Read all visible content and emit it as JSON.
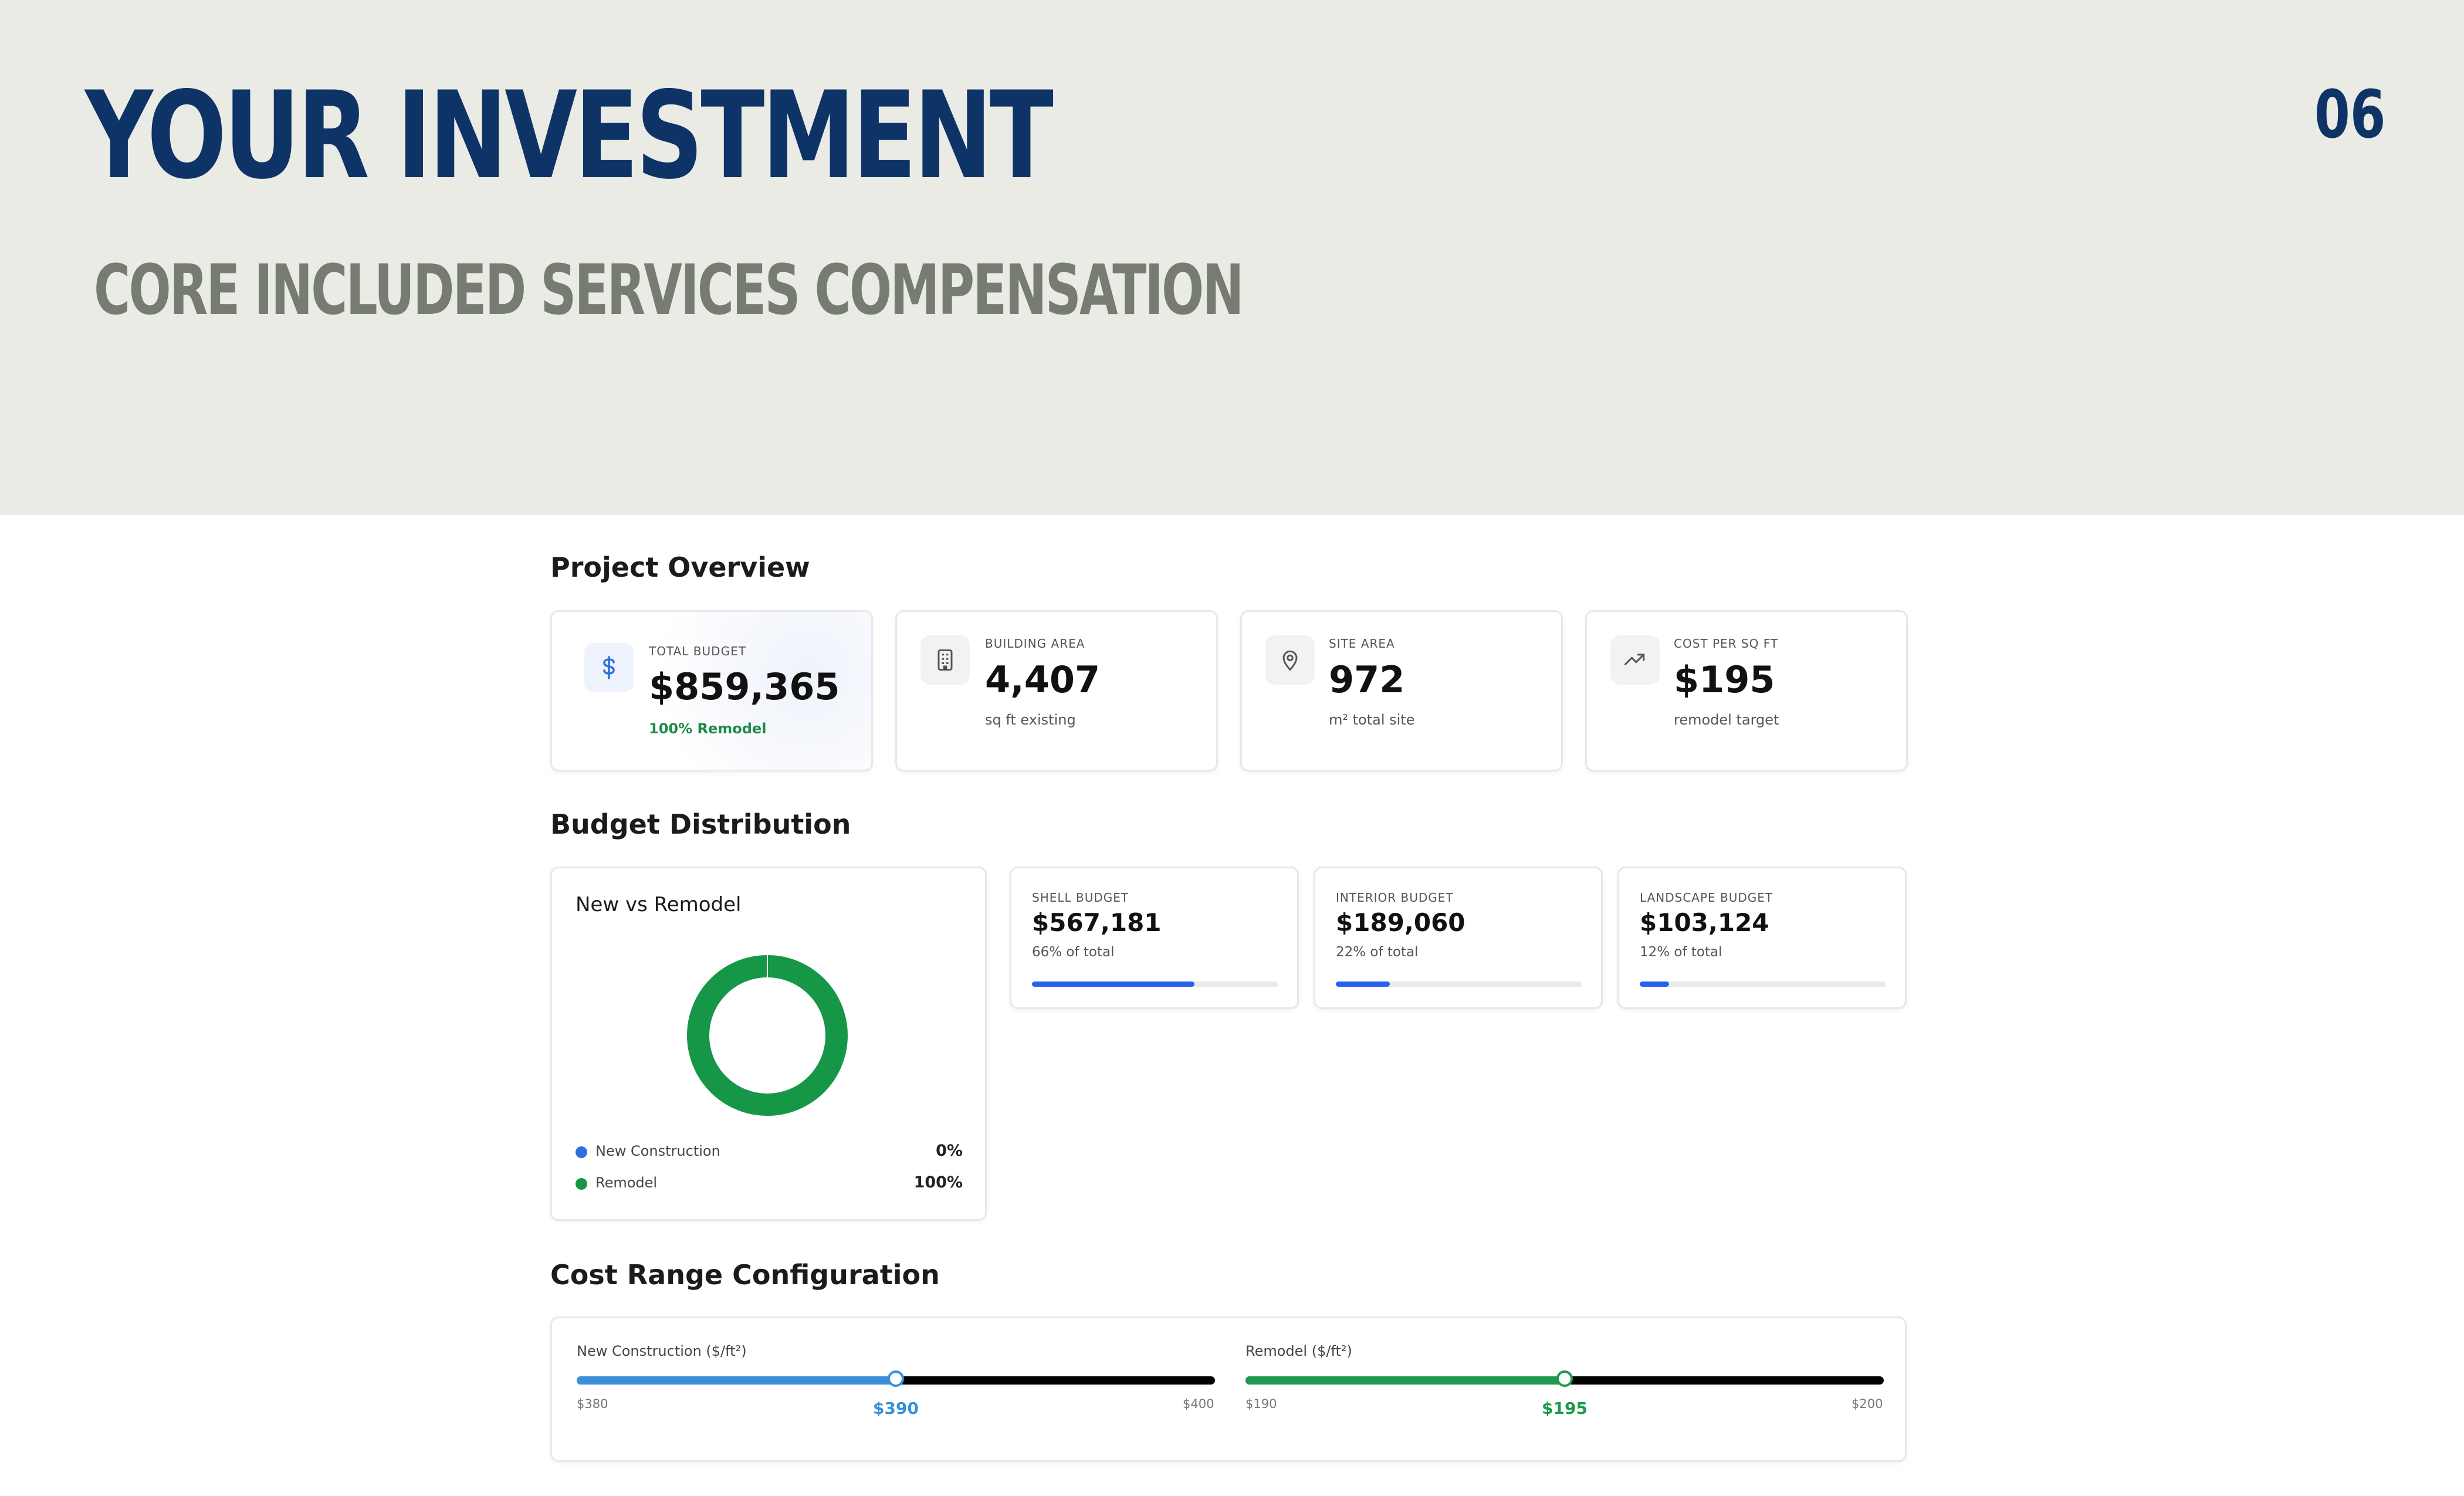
{
  "header": {
    "title": "YOUR INVESTMENT",
    "subtitle": "CORE INCLUDED SERVICES COMPENSATION",
    "page_number": "06"
  },
  "overview": {
    "heading": "Project Overview",
    "cards": [
      {
        "icon": "dollar-icon",
        "label": "TOTAL BUDGET",
        "value": "$859,365",
        "sub": "100% Remodel"
      },
      {
        "icon": "building-icon",
        "label": "BUILDING AREA",
        "value": "4,407",
        "sub": "sq ft existing"
      },
      {
        "icon": "map-pin-icon",
        "label": "SITE AREA",
        "value": "972",
        "sub": "m² total site"
      },
      {
        "icon": "trend-up-icon",
        "label": "COST PER SQ FT",
        "value": "$195",
        "sub": "remodel target"
      }
    ]
  },
  "budget": {
    "heading": "Budget Distribution",
    "chart": {
      "title": "New vs Remodel",
      "items": [
        {
          "name": "New Construction",
          "percent": 0,
          "display": "0%",
          "color": "#2f6fe0"
        },
        {
          "name": "Remodel",
          "percent": 100,
          "display": "100%",
          "color": "#169748"
        }
      ]
    },
    "breakdown": [
      {
        "label": "SHELL BUDGET",
        "value": "$567,181",
        "pct_text": "66% of total",
        "fraction": 0.66
      },
      {
        "label": "INTERIOR BUDGET",
        "value": "$189,060",
        "pct_text": "22% of total",
        "fraction": 0.22
      },
      {
        "label": "LANDSCAPE BUDGET",
        "value": "$103,124",
        "pct_text": "12% of total",
        "fraction": 0.12
      }
    ]
  },
  "cost_range": {
    "heading": "Cost Range Configuration",
    "sliders": [
      {
        "label": "New Construction ($/ft²)",
        "min": 380,
        "max": 400,
        "value": 390,
        "min_text": "$380",
        "max_text": "$400",
        "value_text": "$390",
        "accent": "#3a8fd9"
      },
      {
        "label": "Remodel ($/ft²)",
        "min": 190,
        "max": 200,
        "value": 195,
        "min_text": "$190",
        "max_text": "$200",
        "value_text": "$195",
        "accent": "#1e9a4c"
      }
    ]
  },
  "colors": {
    "brand_navy": "#0e3366",
    "subtitle_gray": "#767c72",
    "band_bg": "#ebebe5",
    "bar_blue": "#2563eb",
    "remodel_green": "#169748"
  }
}
